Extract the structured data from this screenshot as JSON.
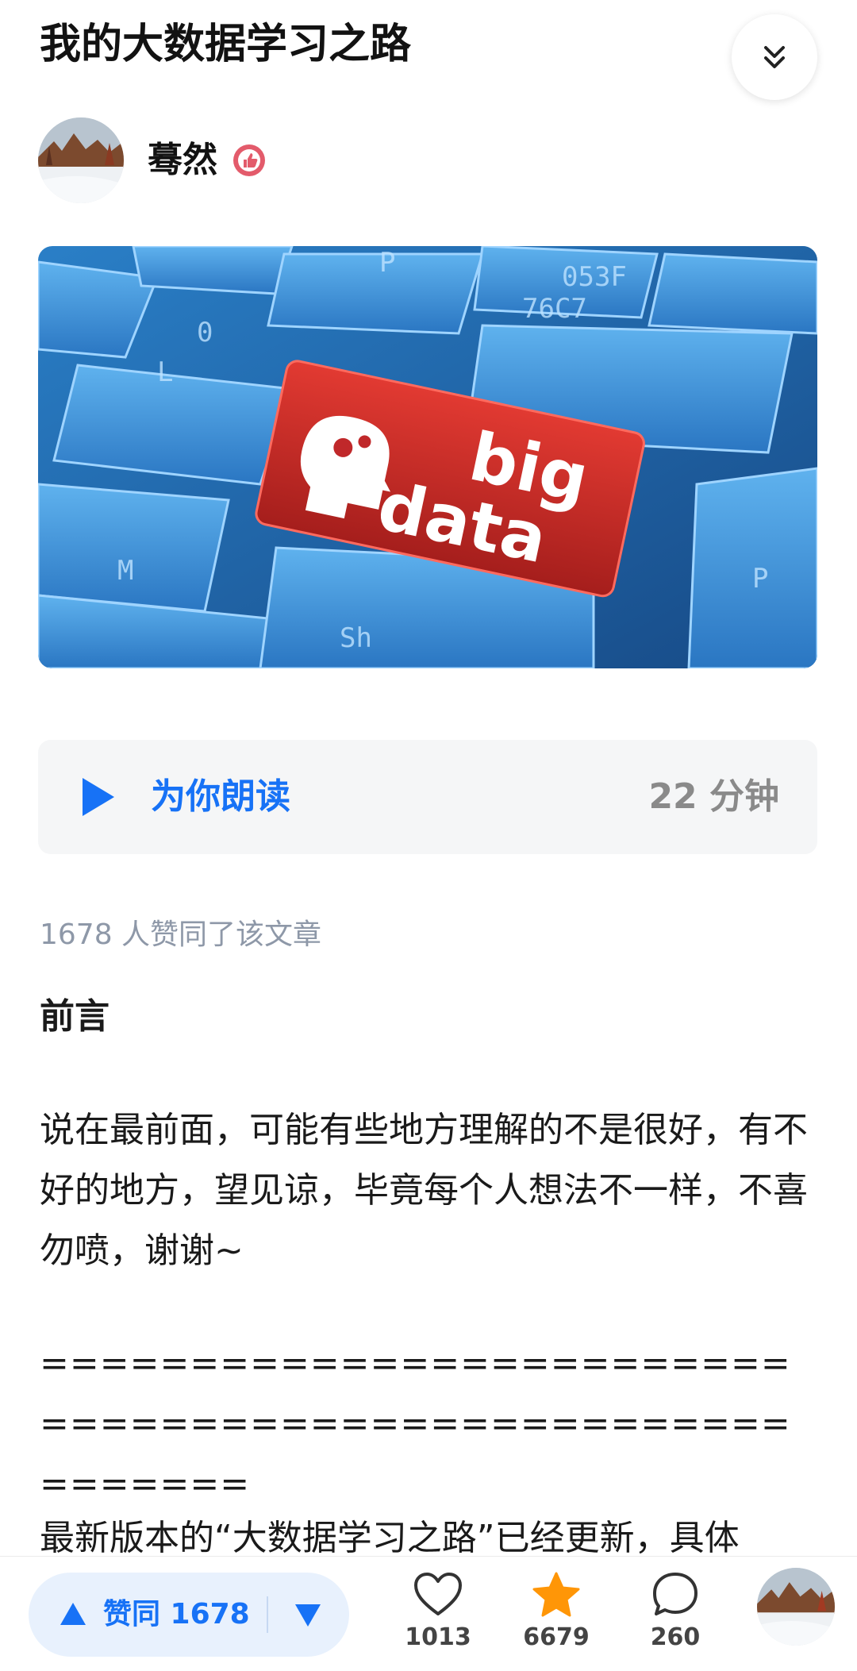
{
  "article": {
    "title": "我的大数据学习之路",
    "author_name": "蓦然",
    "cover_text_top": "big",
    "cover_text_bottom": "data"
  },
  "listen": {
    "label": "为你朗读",
    "duration": "22 分钟"
  },
  "agree_summary": "1678 人赞同了该文章",
  "content": {
    "heading": "前言",
    "paragraph1": "说在最前面，可能有些地方理解的不是很好，有不好的地方，望见谅，毕竟每个人想法不一样，不喜勿喷，谢谢~",
    "separator": "=========================================================",
    "paragraph2": "最新版本的“大数据学习之路”已经更新，具体"
  },
  "actions": {
    "vote_up_label": "赞同 1678",
    "like_count": "1013",
    "favorite_count": "6679",
    "comment_count": "260"
  },
  "colors": {
    "accent": "#1772f6",
    "favorite": "#ff9607",
    "cover_key": "#c8282a"
  }
}
